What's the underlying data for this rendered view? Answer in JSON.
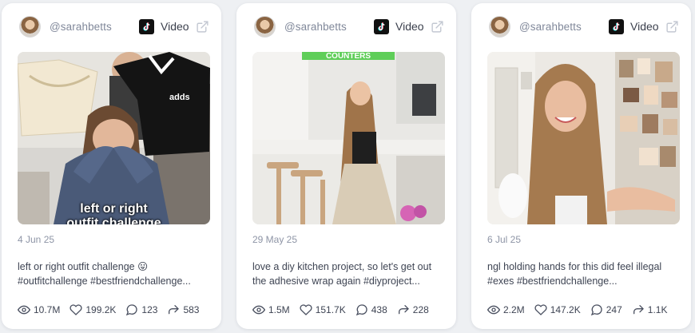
{
  "platform": {
    "label": "Video",
    "icon": "tiktok-logo-icon"
  },
  "posts": [
    {
      "handle": "@sarahbetts",
      "date": "4 Jun 25",
      "overlay_caption_line1": "left or right",
      "overlay_caption_line2": "outfit challenge",
      "text_line1": "left or right outfit challenge 😛",
      "text_line2": "#outfitchallenge #bestfriendchallenge...",
      "views": "10.7M",
      "likes": "199.2K",
      "comments": "123",
      "shares": "583"
    },
    {
      "handle": "@sarahbetts",
      "date": "29 May 25",
      "overlay_banner": "COUNTERS",
      "text_line1": "love a diy kitchen project, so let's get out",
      "text_line2": "the adhesive wrap again #diyproject...",
      "views": "1.5M",
      "likes": "151.7K",
      "comments": "438",
      "shares": "228"
    },
    {
      "handle": "@sarahbetts",
      "date": "6 Jul 25",
      "text_line1": "ngl holding hands for this did feel illegal",
      "text_line2": "#exes #bestfriendchallenge...",
      "views": "2.2M",
      "likes": "147.2K",
      "comments": "247",
      "shares": "1.1K"
    }
  ],
  "colors": {
    "background": "#eef0f3",
    "card": "#ffffff",
    "muted_text": "#80889a",
    "body_text": "#3e4453",
    "banner_green": "#5fce59"
  }
}
